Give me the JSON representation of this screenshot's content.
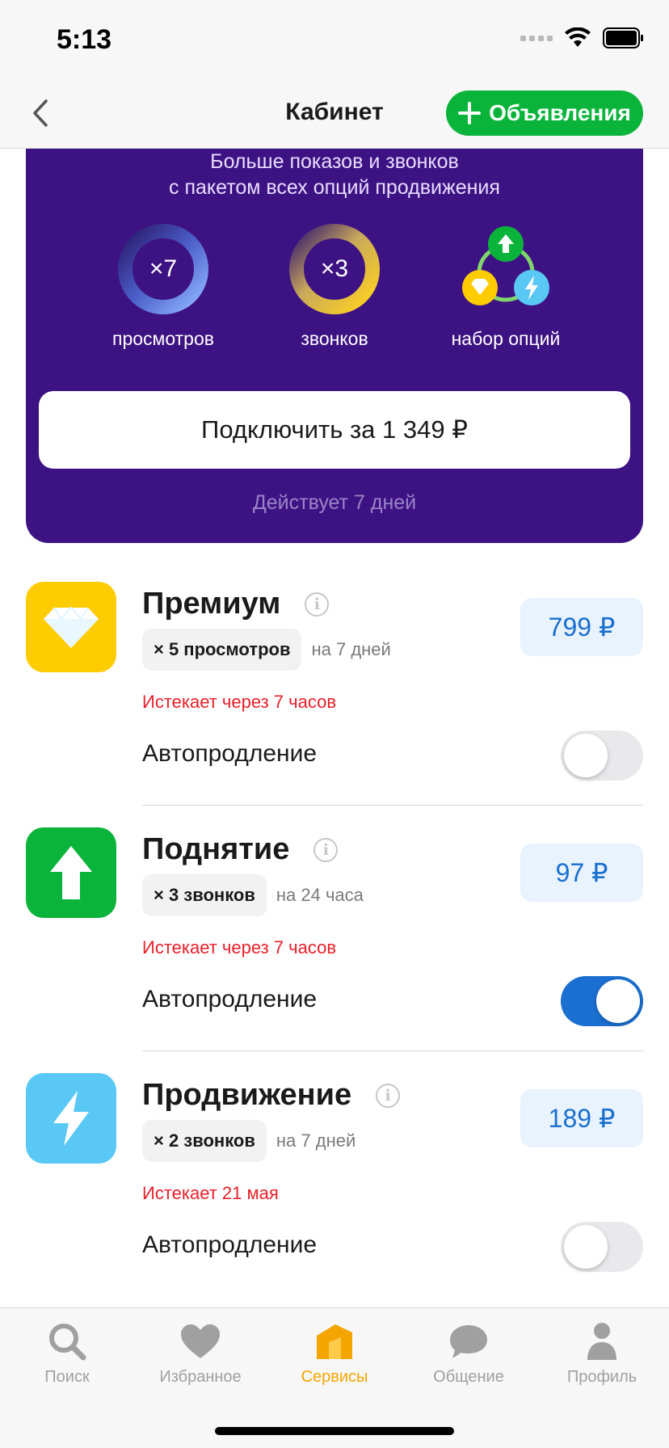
{
  "status_bar": {
    "time": "5:13"
  },
  "nav": {
    "title": "Кабинет",
    "ads_button_label": "Объявления"
  },
  "promo": {
    "line1": "Больше показов и звонков",
    "line2": "с пакетом всех опций продвижения",
    "stats": [
      {
        "value": "×7",
        "caption": "просмотров"
      },
      {
        "value": "×3",
        "caption": "звонков"
      },
      {
        "value": "",
        "caption": "набор опций"
      }
    ],
    "connect_label": "Подключить за 1 349 ₽",
    "validity": "Действует 7 дней"
  },
  "services": [
    {
      "title": "Премиум",
      "chip": "× 5 просмотров",
      "duration": "на 7 дней",
      "expires": "Истекает через 7 часов",
      "price": "799 ₽",
      "auto_label": "Автопродление",
      "auto_on": false,
      "icon": "diamond-icon",
      "color": "#ffcc00"
    },
    {
      "title": "Поднятие",
      "chip": "× 3 звонков",
      "duration": "на 24 часа",
      "expires": "Истекает через 7 часов",
      "price": "97 ₽",
      "auto_label": "Автопродление",
      "auto_on": true,
      "icon": "arrow-up-icon",
      "color": "#0ab43a"
    },
    {
      "title": "Продвижение",
      "chip": "× 2 звонков",
      "duration": "на 7 дней",
      "expires": "Истекает 21 мая",
      "price": "189 ₽",
      "auto_label": "Автопродление",
      "auto_on": false,
      "icon": "lightning-icon",
      "color": "#5ac8f5"
    }
  ],
  "tabs": [
    {
      "label": "Поиск",
      "icon": "search-icon",
      "active": false
    },
    {
      "label": "Избранное",
      "icon": "heart-icon",
      "active": false
    },
    {
      "label": "Сервисы",
      "icon": "services-icon",
      "active": true
    },
    {
      "label": "Общение",
      "icon": "chat-icon",
      "active": false
    },
    {
      "label": "Профиль",
      "icon": "profile-icon",
      "active": false
    }
  ],
  "colors": {
    "accent_green": "#0ab43a",
    "promo_bg": "#3d1283",
    "price_blue": "#1a6fd0",
    "warning_red": "#e8202a",
    "active_tab": "#f5a500"
  }
}
